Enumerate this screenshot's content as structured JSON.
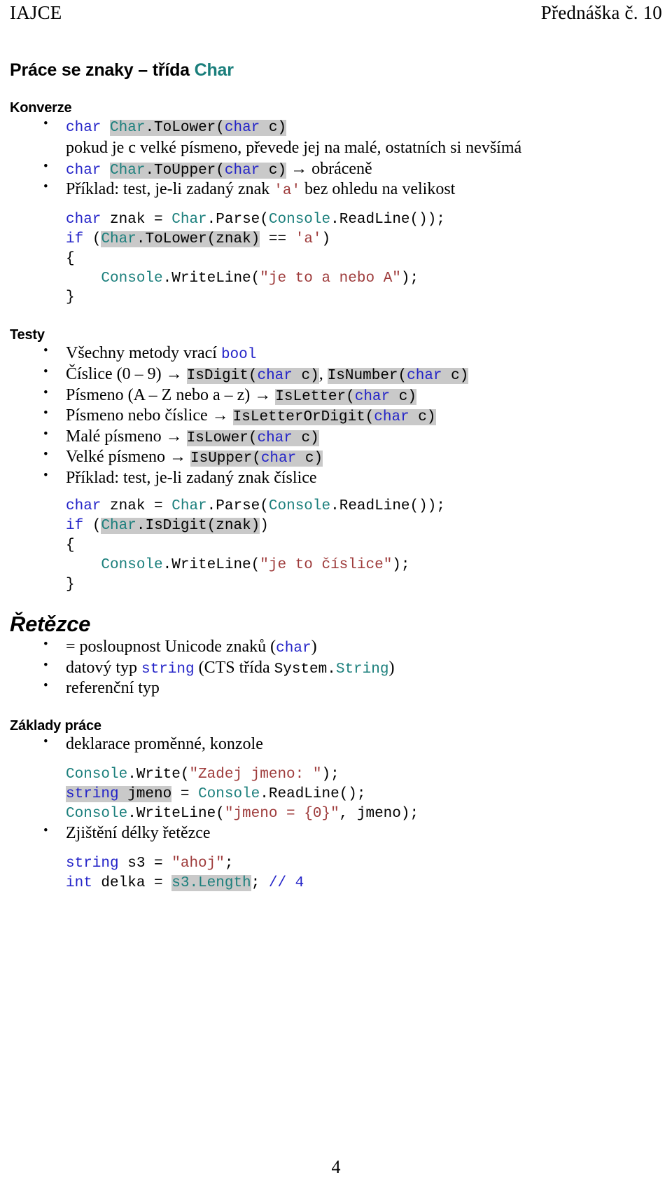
{
  "header": {
    "left": "IAJCE",
    "right": "Přednáška č. 10"
  },
  "title": {
    "text": "Práce se znaky – třída ",
    "accent": "Char"
  },
  "sections": {
    "konverze": "Konverze",
    "testy": "Testy",
    "retezce": "Řetězce",
    "zaklady": "Základy práce"
  },
  "konverze_items": {
    "b1_code": {
      "kw1": "char",
      "type1": "Char",
      "mid": ".ToLower(",
      "kw2": "char",
      "tail": " c)"
    },
    "b1_desc": "pokud je c velké písmeno, převede jej na malé, ostatních si nevšímá",
    "b2_code": {
      "kw1": "char",
      "type1": "Char",
      "mid": ".ToUpper(",
      "kw2": "char",
      "tail": " c)"
    },
    "b2_after": " → obráceně",
    "b3_pre": "Příklad: test, je-li zadaný znak ",
    "b3_lit": "'a'",
    "b3_post": " bez ohledu na velikost"
  },
  "code1": {
    "l1_kw": "char",
    "l1_a": " znak = ",
    "l1_t1": "Char",
    "l1_b": ".Parse(",
    "l1_t2": "Console",
    "l1_c": ".ReadLine());",
    "l2_kw": "if",
    "l2_a": " (",
    "l2_t1": "Char",
    "l2_b": ".ToLower(znak)",
    "l2_c": " == ",
    "l2_lit": "'a'",
    "l2_d": ")",
    "l3": "{",
    "l4_indent": "    ",
    "l4_t": "Console",
    "l4_a": ".WriteLine(",
    "l4_str": "\"je to a nebo A\"",
    "l4_b": ");",
    "l5": "}"
  },
  "testy_items": {
    "t1_pre": "Všechny metody vrací ",
    "t1_kw": "bool",
    "t2_pre": "Číslice (0 – 9) → ",
    "t2_c1_a": "IsDigit(",
    "t2_c1_kw": "char",
    "t2_c1_b": " c)",
    "t2_sep": ", ",
    "t2_c2_a": "IsNumber(",
    "t2_c2_kw": "char",
    "t2_c2_b": " c)",
    "t3_pre": "Písmeno (A – Z nebo a – z) → ",
    "t3_a": "IsLetter(",
    "t3_kw": "char",
    "t3_b": " c)",
    "t4_pre": "Písmeno nebo číslice → ",
    "t4_a": "IsLetterOrDigit(",
    "t4_kw": "char",
    "t4_b": " c)",
    "t5_pre": "Malé písmeno → ",
    "t5_a": "IsLower(",
    "t5_kw": "char",
    "t5_b": " c)",
    "t6_pre": "Velké písmeno → ",
    "t6_a": "IsUpper(",
    "t6_kw": "char",
    "t6_b": " c)",
    "t7": "Příklad: test, je-li zadaný znak číslice"
  },
  "code2": {
    "l1_kw": "char",
    "l1_a": " znak = ",
    "l1_t1": "Char",
    "l1_b": ".Parse(",
    "l1_t2": "Console",
    "l1_c": ".ReadLine());",
    "l2_kw": "if",
    "l2_a": " (",
    "l2_t1": "Char",
    "l2_b": ".IsDigit(znak)",
    "l2_c": ")",
    "l3": "{",
    "l4_indent": "    ",
    "l4_t": "Console",
    "l4_a": ".WriteLine(",
    "l4_str": "\"je to číslice\"",
    "l4_b": ");",
    "l5": "}"
  },
  "retezce_items": {
    "r1_pre": "= posloupnost Unicode znaků (",
    "r1_kw": "char",
    "r1_post": ")",
    "r2_pre": "datový typ ",
    "r2_kw": "string",
    "r2_mid": " (CTS třída ",
    "r2_ns": "System.",
    "r2_type": "String",
    "r2_post": ")",
    "r3": "referenční typ"
  },
  "zaklady_items": {
    "z1": "deklarace proměnné, konzole",
    "z2": "Zjištění délky řetězce"
  },
  "code3": {
    "l1_t": "Console",
    "l1_a": ".Write(",
    "l1_str": "\"Zadej jmeno: \"",
    "l1_b": ");",
    "l2_kw": "string",
    "l2_a": " jmeno",
    "l2_b": " = ",
    "l2_t": "Console",
    "l2_c": ".ReadLine();",
    "l3_t": "Console",
    "l3_a": ".WriteLine(",
    "l3_str": "\"jmeno = {0}\"",
    "l3_b": ", jmeno);"
  },
  "code4": {
    "l1_kw": "string",
    "l1_a": " s3 = ",
    "l1_str": "\"ahoj\"",
    "l1_b": ";",
    "l2_kw": "int",
    "l2_a": " delka = ",
    "l2_hl": "s3.Length",
    "l2_b": "; ",
    "l2_cmt": "// 4"
  },
  "footer": {
    "page": "4"
  },
  "colors": {
    "accent_teal": "#1b7f7c",
    "keyword_blue": "#2323c8",
    "string_red": "#9e3b3b",
    "highlight_gray": "#c9c9c9"
  }
}
